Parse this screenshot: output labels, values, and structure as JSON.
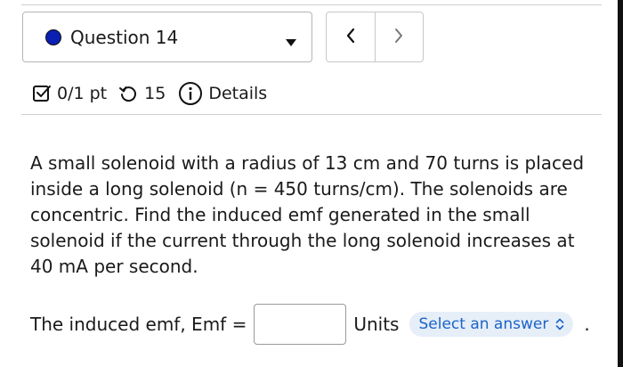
{
  "question_selector": {
    "label": "Question 14",
    "status_color": "#0b1fb3"
  },
  "navigation": {
    "prev_icon": "chevron-left-icon",
    "next_icon": "chevron-right-icon"
  },
  "meta": {
    "score": "0/1 pt",
    "retries": "15",
    "details_label": "Details"
  },
  "question": {
    "text": "A small solenoid with a radius of 13 cm and 70 turns is placed inside a long solenoid (n = 450 turns/cm). The solenoids are concentric. Find the induced emf generated in the small solenoid if the current through the long solenoid increases at 40 mA per second."
  },
  "answer": {
    "label": "The induced emf, Emf =",
    "value": "",
    "units_label": "Units",
    "units_placeholder": "Select an answer",
    "trailing": "."
  },
  "colors": {
    "accent_blue": "#1a64c8",
    "select_bg": "#e6eef8"
  }
}
